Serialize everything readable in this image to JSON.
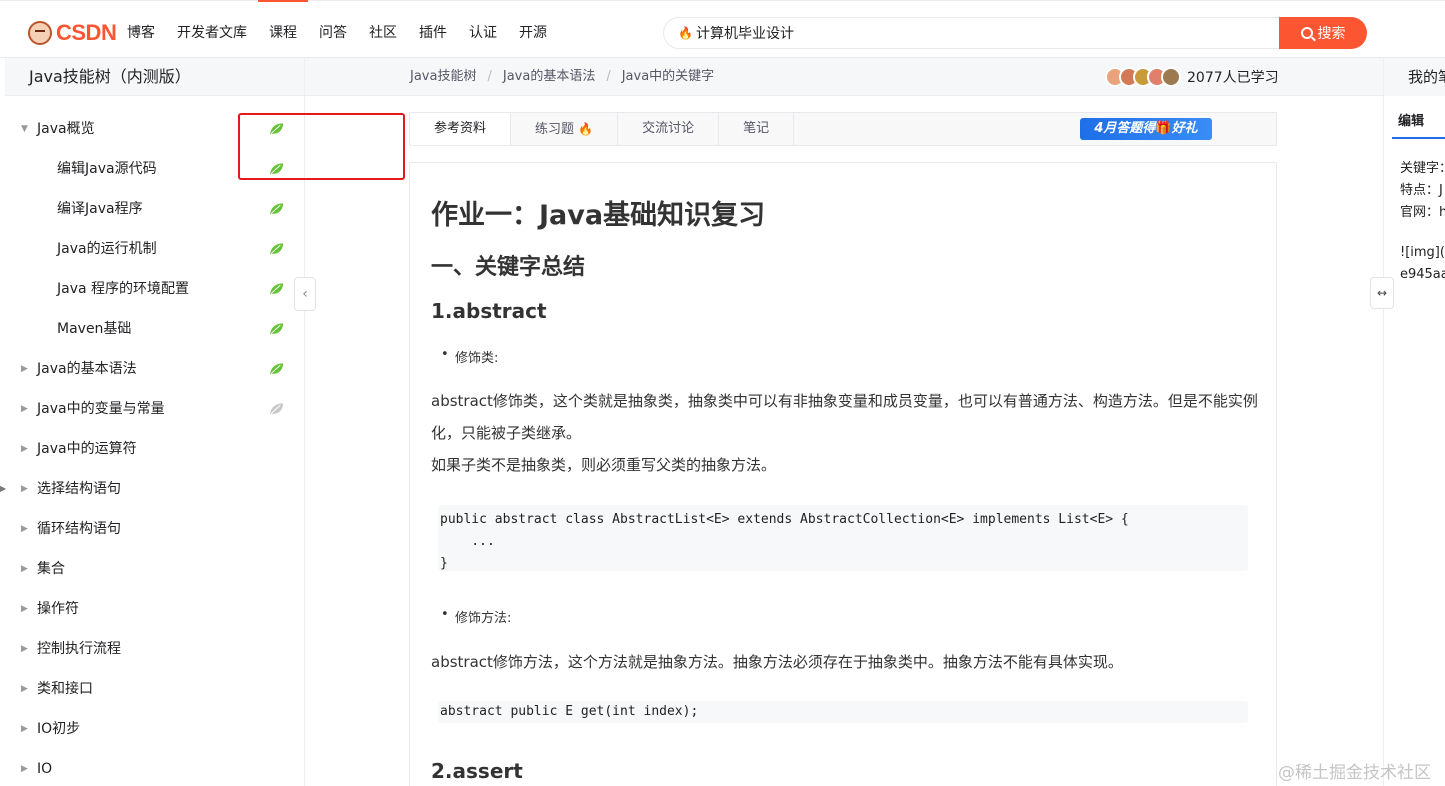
{
  "header": {
    "logo_text": "CSDN",
    "nav": [
      "博客",
      "开发者文库",
      "课程",
      "问答",
      "社区",
      "插件",
      "认证",
      "开源"
    ],
    "active_nav": "课程",
    "search_value": "计算机毕业设计",
    "search_button": "搜索"
  },
  "sidebar": {
    "title": "Java技能树（内测版）",
    "items": [
      {
        "label": "Java概览",
        "expanded": true,
        "leaf": "green"
      },
      {
        "label": "编辑Java源代码",
        "child": true,
        "leaf": "green"
      },
      {
        "label": "编译Java程序",
        "child": true,
        "leaf": "green"
      },
      {
        "label": "Java的运行机制",
        "child": true,
        "leaf": "green"
      },
      {
        "label": "Java 程序的环境配置",
        "child": true,
        "leaf": "green"
      },
      {
        "label": "Maven基础",
        "child": true,
        "leaf": "green"
      },
      {
        "label": "Java的基本语法",
        "leaf": "green"
      },
      {
        "label": "Java中的变量与常量",
        "leaf": "gray"
      },
      {
        "label": "Java中的运算符"
      },
      {
        "label": "选择结构语句"
      },
      {
        "label": "循环结构语句"
      },
      {
        "label": "集合"
      },
      {
        "label": "操作符"
      },
      {
        "label": "控制执行流程"
      },
      {
        "label": "类和接口"
      },
      {
        "label": "IO初步"
      },
      {
        "label": "IO"
      }
    ]
  },
  "breadcrumb": [
    "Java技能树",
    "Java的基本语法",
    "Java中的关键字"
  ],
  "learners": "2077人已学习",
  "tabs": [
    "参考资料",
    "练习题",
    "交流讨论",
    "笔记"
  ],
  "promo": {
    "text": "4月答题得",
    "gift": "🎁",
    "tail": "好礼"
  },
  "article": {
    "title": "作业一：Java基础知识复习",
    "h2": "一、关键字总结",
    "sections": [
      {
        "heading": "1.abstract",
        "bullet1": "修饰类:",
        "para1": "abstract修饰类，这个类就是抽象类，抽象类中可以有非抽象变量和成员变量，也可以有普通方法、构造方法。但是不能实例化，只能被子类继承。",
        "para2": "如果子类不是抽象类，则必须重写父类的抽象方法。",
        "code1": "public abstract class AbstractList<E> extends AbstractCollection<E> implements List<E> {\n    ...\n}",
        "bullet2": "修饰方法:",
        "para3": "abstract修饰方法，这个方法就是抽象方法。抽象方法必须存在于抽象类中。抽象方法不能有具体实现。",
        "code2": "abstract public E get(int index);"
      },
      {
        "heading": "2.assert"
      }
    ]
  },
  "right_panel": {
    "title": "我的笔记",
    "tab": "编辑",
    "lines": [
      "关键字：",
      "特点：J",
      "官网：h",
      "![img](h",
      "e945aa"
    ]
  },
  "watermark": "@稀土掘金技术社区",
  "colors": {
    "accent": "#fc5531",
    "leaf_green": "#67c23a",
    "leaf_gray": "#c8c8c8",
    "highlight": "#e5181b"
  }
}
